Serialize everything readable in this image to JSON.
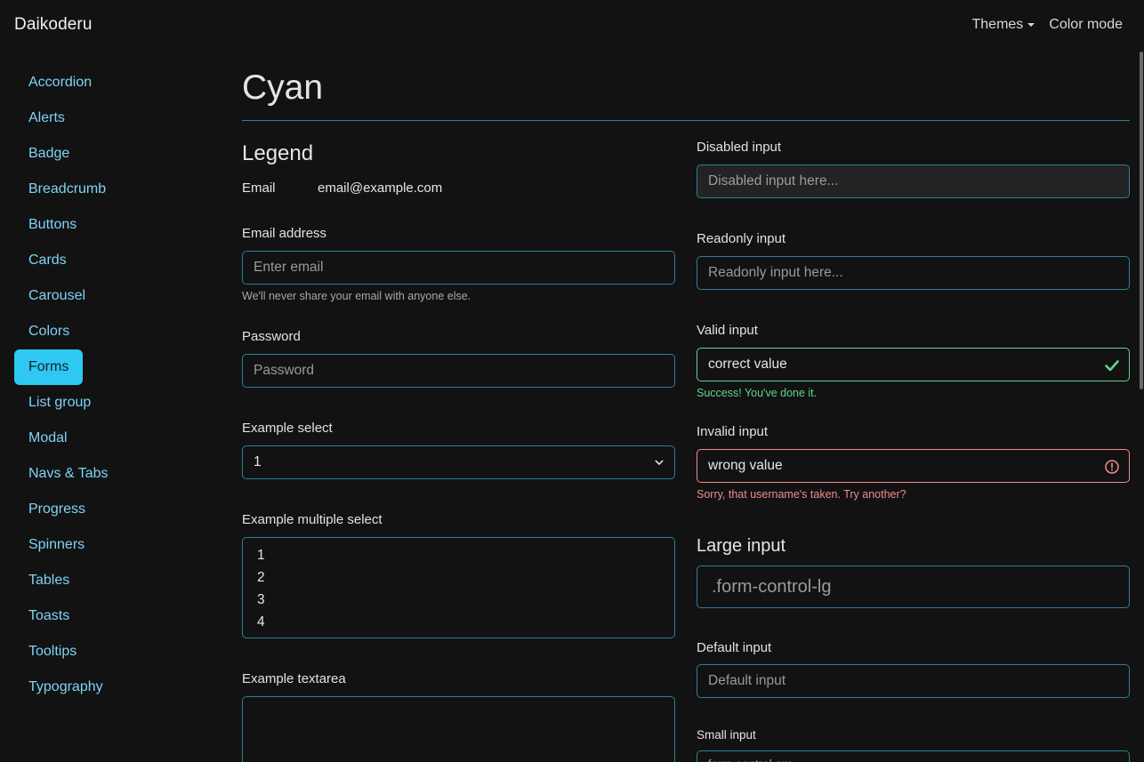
{
  "navbar": {
    "brand": "Daikoderu",
    "themes_label": "Themes",
    "color_mode_label": "Color mode"
  },
  "sidebar": {
    "items": [
      {
        "label": "Accordion"
      },
      {
        "label": "Alerts"
      },
      {
        "label": "Badge"
      },
      {
        "label": "Breadcrumb"
      },
      {
        "label": "Buttons"
      },
      {
        "label": "Cards"
      },
      {
        "label": "Carousel"
      },
      {
        "label": "Colors"
      },
      {
        "label": "Forms",
        "active": true
      },
      {
        "label": "List group"
      },
      {
        "label": "Modal"
      },
      {
        "label": "Navs & Tabs"
      },
      {
        "label": "Progress"
      },
      {
        "label": "Spinners"
      },
      {
        "label": "Tables"
      },
      {
        "label": "Toasts"
      },
      {
        "label": "Tooltips"
      },
      {
        "label": "Typography"
      }
    ]
  },
  "main": {
    "title": "Cyan",
    "legend": "Legend",
    "static_email": {
      "label": "Email",
      "value": "email@example.com"
    },
    "email": {
      "label": "Email address",
      "placeholder": "Enter email",
      "help": "We'll never share your email with anyone else."
    },
    "password": {
      "label": "Password",
      "placeholder": "Password"
    },
    "select": {
      "label": "Example select",
      "selected": "1"
    },
    "multi_select": {
      "label": "Example multiple select",
      "options": [
        "1",
        "2",
        "3",
        "4"
      ]
    },
    "textarea": {
      "label": "Example textarea"
    },
    "disabled": {
      "label": "Disabled input",
      "placeholder": "Disabled input here..."
    },
    "readonly": {
      "label": "Readonly input",
      "placeholder": "Readonly input here..."
    },
    "valid": {
      "label": "Valid input",
      "value": "correct value",
      "feedback": "Success! You've done it."
    },
    "invalid": {
      "label": "Invalid input",
      "value": "wrong value",
      "feedback": "Sorry, that username's taken. Try another?"
    },
    "large": {
      "heading": "Large input",
      "placeholder": ".form-control-lg"
    },
    "default": {
      "label": "Default input",
      "placeholder": "Default input"
    },
    "small": {
      "label": "Small input",
      "placeholder": ".form-control-sm"
    }
  },
  "colors": {
    "background": "#121212",
    "accent": "#2ec8f2",
    "link": "#7fd3f5",
    "border": "#2a7f99",
    "valid": "#5fd68f",
    "invalid": "#f08c8c"
  }
}
